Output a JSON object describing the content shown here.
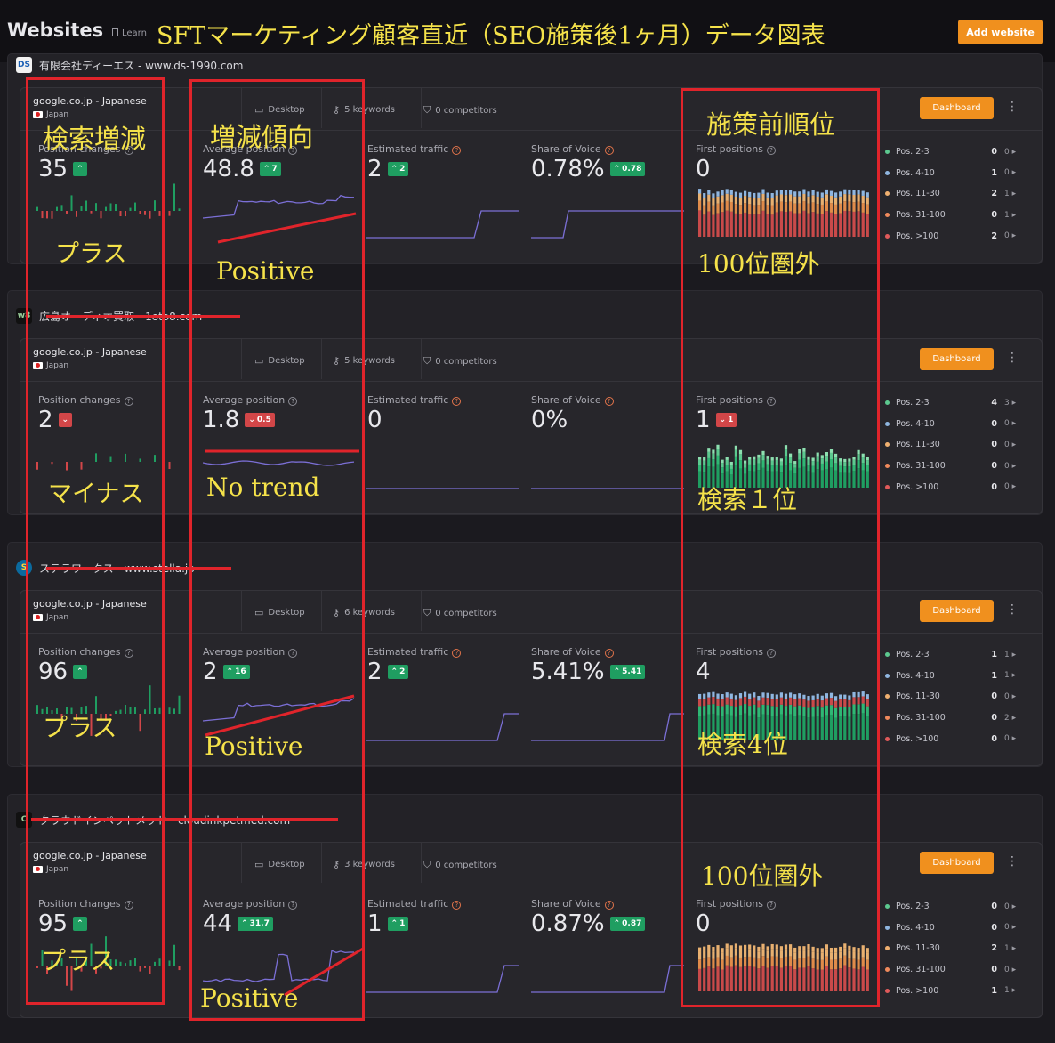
{
  "header": {
    "brand": "Websites",
    "learn": "Learn",
    "title": "SFTマーケティング顧客直近（SEO施策後1ヶ月）データ図表",
    "add_website": "Add website"
  },
  "labels": {
    "desktop": "Desktop",
    "competitors": "0 competitors",
    "dashboard": "Dashboard",
    "position_changes": "Position changes",
    "average_position": "Average position",
    "estimated_traffic": "Estimated traffic",
    "share_of_voice": "Share of Voice",
    "first_positions": "First positions",
    "pos_labels": [
      "Pos. 2-3",
      "Pos. 4-10",
      "Pos. 11-30",
      "Pos. 31-100",
      "Pos. >100"
    ]
  },
  "colors": {
    "accent_orange": "#f0901e",
    "up_green": "#1f9e61",
    "down_red": "#d24648",
    "annotation_yellow": "#f5e24a",
    "annotation_red": "#e0242b",
    "pos_dots": [
      "#5cc98f",
      "#8fb6e0",
      "#f0b070",
      "#f08a5c",
      "#e05a5a"
    ]
  },
  "annotations": {
    "col1_header": "検索増減",
    "col2_header": "増減傾向",
    "col3_header": "施策前順位",
    "site1_col1": "プラス",
    "site1_col2": "Positive",
    "site1_col3": "100位圏外",
    "site2_col1": "マイナス",
    "site2_col2": "No trend",
    "site2_col3": "検索１位",
    "site3_col1": "プラス",
    "site3_col2": "Positive",
    "site3_col3": "検索4位",
    "site4_col1": "プラス",
    "site4_col2": "Positive",
    "site4_col3": "100位圏外"
  },
  "sites": [
    {
      "name": "有限会社ディーエス - www.ds-1990.com",
      "engine": "google.co.jp - Japanese",
      "country": "Japan",
      "keywords": "5 keywords",
      "position_changes": "35",
      "position_changes_dir": "up",
      "avg_position": "48.8",
      "avg_delta": "7",
      "avg_dir": "up",
      "traffic": "2",
      "traffic_delta": "2",
      "traffic_dir": "up",
      "sov": "0.78%",
      "sov_delta": "0.78",
      "first_positions": "0",
      "first_delta": "",
      "dist": [
        [
          "0",
          "0"
        ],
        [
          "1",
          "0"
        ],
        [
          "2",
          "1"
        ],
        [
          "0",
          "1"
        ],
        [
          "2",
          "0"
        ]
      ]
    },
    {
      "name": "広島オーディオ買取 - 1oto8.com",
      "engine": "google.co.jp - Japanese",
      "country": "Japan",
      "keywords": "5 keywords",
      "position_changes": "2",
      "position_changes_dir": "down",
      "avg_position": "1.8",
      "avg_delta": "0.5",
      "avg_dir": "down",
      "traffic": "0",
      "traffic_delta": "",
      "traffic_dir": "",
      "sov": "0%",
      "sov_delta": "",
      "first_positions": "1",
      "first_delta": "1",
      "dist": [
        [
          "4",
          "3"
        ],
        [
          "0",
          "0"
        ],
        [
          "0",
          "0"
        ],
        [
          "0",
          "0"
        ],
        [
          "0",
          "0"
        ]
      ]
    },
    {
      "name": "ステラワークス - www.stella.jp",
      "engine": "google.co.jp - Japanese",
      "country": "Japan",
      "keywords": "6 keywords",
      "position_changes": "96",
      "position_changes_dir": "up",
      "avg_position": "2",
      "avg_delta": "16",
      "avg_dir": "up",
      "traffic": "2",
      "traffic_delta": "2",
      "traffic_dir": "up",
      "sov": "5.41%",
      "sov_delta": "5.41",
      "first_positions": "4",
      "first_delta": "",
      "dist": [
        [
          "1",
          "1"
        ],
        [
          "1",
          "1"
        ],
        [
          "0",
          "0"
        ],
        [
          "0",
          "2"
        ],
        [
          "0",
          "0"
        ]
      ]
    },
    {
      "name": "クラウドインペットメッド - cloudinkpetmed.com",
      "engine": "google.co.jp - Japanese",
      "country": "Japan",
      "keywords": "3 keywords",
      "position_changes": "95",
      "position_changes_dir": "up",
      "avg_position": "44",
      "avg_delta": "31.7",
      "avg_dir": "up",
      "traffic": "1",
      "traffic_delta": "1",
      "traffic_dir": "up",
      "sov": "0.87%",
      "sov_delta": "0.87",
      "first_positions": "0",
      "first_delta": "",
      "dist": [
        [
          "0",
          "0"
        ],
        [
          "0",
          "0"
        ],
        [
          "2",
          "1"
        ],
        [
          "0",
          "0"
        ],
        [
          "1",
          "1"
        ]
      ]
    }
  ]
}
